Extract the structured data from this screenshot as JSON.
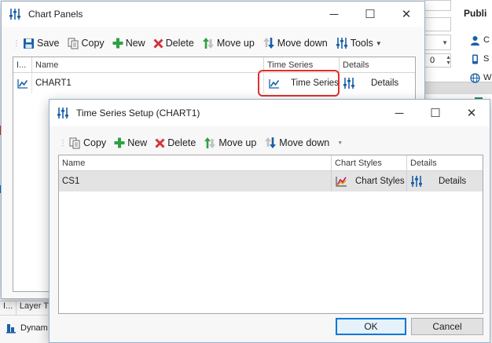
{
  "background": {
    "right_panel_heading": "Publi",
    "right_items": [
      {
        "icon": "user-icon",
        "text": "C"
      },
      {
        "icon": "phone-icon",
        "text": "S"
      },
      {
        "icon": "globe-icon",
        "text": "W"
      }
    ],
    "spinner_value": "0",
    "bottom_grid": {
      "col_index": "I...",
      "col_layer": "Layer T",
      "row_text": "Dynam"
    }
  },
  "chart_panels": {
    "title": "Chart Panels",
    "toolbar": {
      "save": "Save",
      "copy": "Copy",
      "new": "New",
      "delete": "Delete",
      "move_up": "Move up",
      "move_down": "Move down",
      "tools": "Tools"
    },
    "columns": {
      "index": "I...",
      "name": "Name",
      "time_series": "Time Series",
      "details": "Details"
    },
    "rows": [
      {
        "name": "CHART1",
        "time_series": "Time Series",
        "details": "Details"
      }
    ]
  },
  "time_series_setup": {
    "title": "Time Series Setup (CHART1)",
    "toolbar": {
      "copy": "Copy",
      "new": "New",
      "delete": "Delete",
      "move_up": "Move up",
      "move_down": "Move down"
    },
    "columns": {
      "name": "Name",
      "chart_styles": "Chart Styles",
      "details": "Details"
    },
    "rows": [
      {
        "name": "CS1",
        "chart_styles": "Chart Styles",
        "details": "Details"
      }
    ],
    "ok_label": "OK",
    "cancel_label": "Cancel"
  },
  "colors": {
    "highlight": "#e0302a",
    "accent": "#0078d7"
  }
}
